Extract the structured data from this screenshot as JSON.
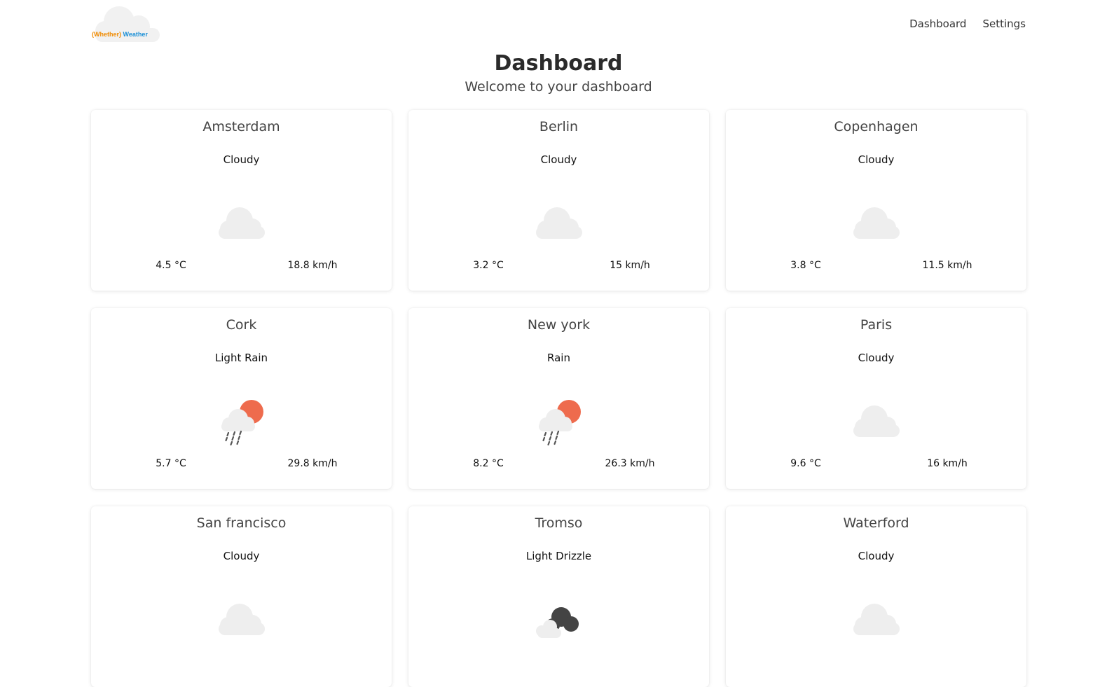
{
  "brand": {
    "part1": "(Whether)",
    "part2": "Weather"
  },
  "nav": {
    "dashboard": "Dashboard",
    "settings": "Settings"
  },
  "header": {
    "title": "Dashboard",
    "subtitle": "Welcome to your dashboard"
  },
  "colors": {
    "cloud": "#eeeeee",
    "sun": "#ee6b4d",
    "rain": "#555555",
    "dark_cloud": "#444444",
    "logo_orange": "#f08a00",
    "logo_blue": "#1a8fd6"
  },
  "cities": [
    {
      "name": "Amsterdam",
      "condition": "Cloudy",
      "icon": "cloudy-icon",
      "temp": "4.5 °C",
      "wind": "18.8 km/h"
    },
    {
      "name": "Berlin",
      "condition": "Cloudy",
      "icon": "cloudy-icon",
      "temp": "3.2 °C",
      "wind": "15 km/h"
    },
    {
      "name": "Copenhagen",
      "condition": "Cloudy",
      "icon": "cloudy-icon",
      "temp": "3.8 °C",
      "wind": "11.5 km/h"
    },
    {
      "name": "Cork",
      "condition": "Light Rain",
      "icon": "sun-rain-icon",
      "temp": "5.7 °C",
      "wind": "29.8 km/h"
    },
    {
      "name": "New york",
      "condition": "Rain",
      "icon": "sun-rain-icon",
      "temp": "8.2 °C",
      "wind": "26.3 km/h"
    },
    {
      "name": "Paris",
      "condition": "Cloudy",
      "icon": "cloudy-icon",
      "temp": "9.6 °C",
      "wind": "16 km/h"
    },
    {
      "name": "San francisco",
      "condition": "Cloudy",
      "icon": "cloudy-icon",
      "temp": "",
      "wind": ""
    },
    {
      "name": "Tromso",
      "condition": "Light Drizzle",
      "icon": "dark-cloud-icon",
      "temp": "",
      "wind": ""
    },
    {
      "name": "Waterford",
      "condition": "Cloudy",
      "icon": "cloudy-icon",
      "temp": "",
      "wind": ""
    }
  ]
}
